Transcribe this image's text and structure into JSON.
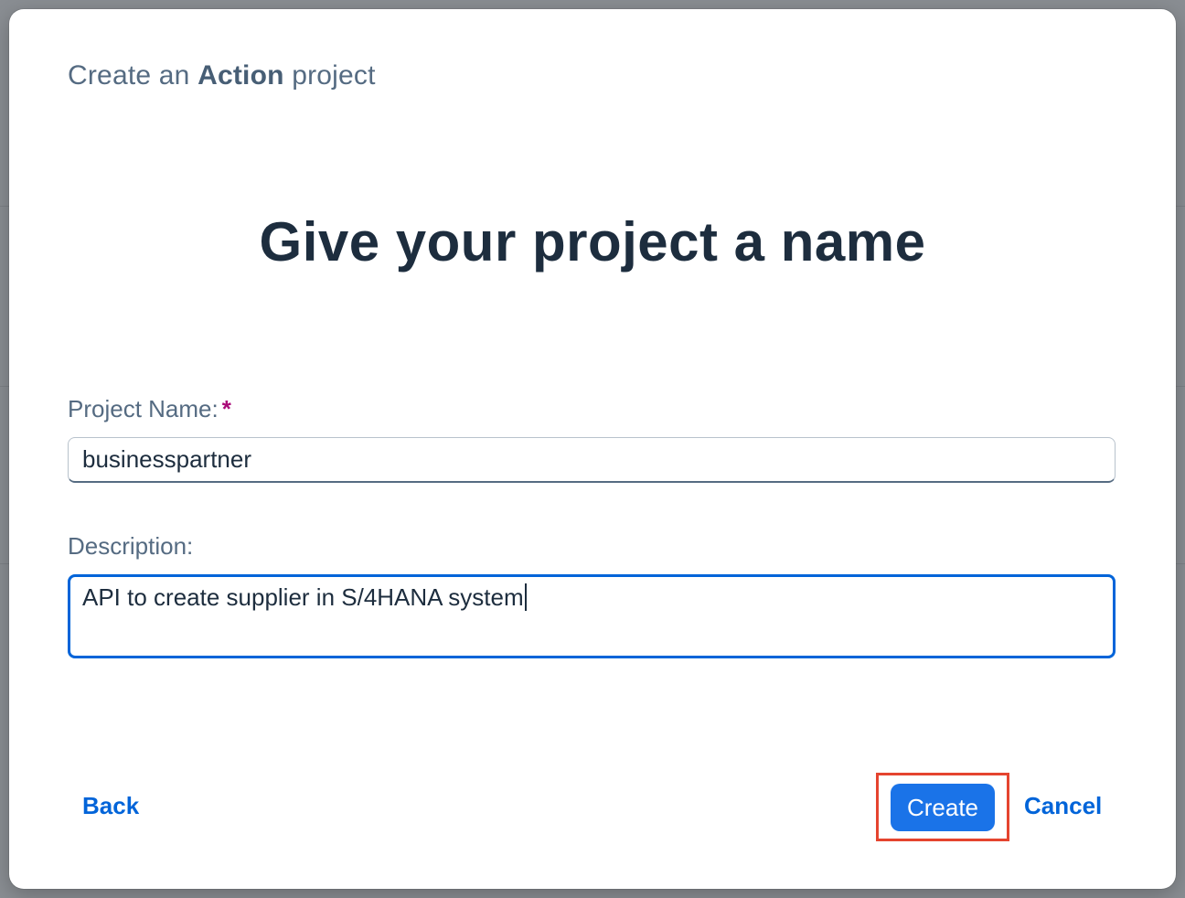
{
  "dialog": {
    "subtitle_prefix": "Create an",
    "subtitle_emphasis": "Action",
    "subtitle_suffix": "project",
    "title": "Give your project a name"
  },
  "form": {
    "name_label": "Project Name:",
    "name_required_marker": "*",
    "name_value": "businesspartner",
    "description_label": "Description:",
    "description_value": "API to create supplier in S/4HANA system"
  },
  "footer": {
    "back_label": "Back",
    "create_label": "Create",
    "cancel_label": "Cancel"
  },
  "colors": {
    "accent": "#0064d9",
    "primary_button": "#1a73e8",
    "required": "#aa0a78",
    "highlight": "#e5442f"
  }
}
